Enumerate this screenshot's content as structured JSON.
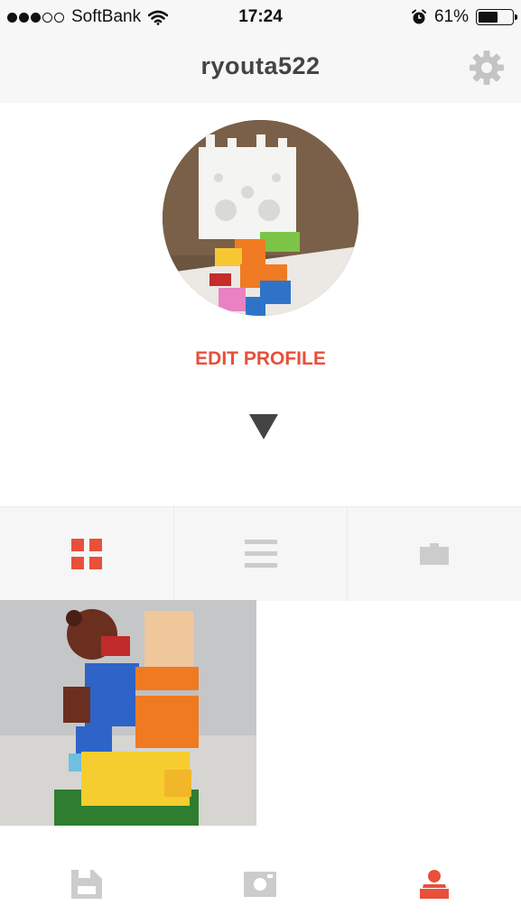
{
  "status_bar": {
    "carrier": "SoftBank",
    "time": "17:24",
    "battery_percent": "61%",
    "battery_level": 0.61,
    "signal_bars_filled": 3,
    "signal_bars_total": 5,
    "icons": [
      "wifi-icon",
      "alarm-icon",
      "battery-icon"
    ]
  },
  "header": {
    "username": "ryouta522",
    "settings_icon": "gear-icon"
  },
  "profile": {
    "edit_label": "EDIT PROFILE",
    "expand_icon": "triangle-down-icon"
  },
  "tabs": [
    {
      "icon": "grid-icon",
      "active": true
    },
    {
      "icon": "list-icon",
      "active": false
    },
    {
      "icon": "briefcase-icon",
      "active": false
    }
  ],
  "bottom_nav": [
    {
      "icon": "save-icon",
      "active": false
    },
    {
      "icon": "camera-icon",
      "active": false
    },
    {
      "icon": "profile-icon",
      "active": true
    }
  ],
  "colors": {
    "accent": "#e8503a",
    "inactive_icon": "#cccccc",
    "header_bg": "#f7f7f7",
    "title_text": "#444444"
  }
}
